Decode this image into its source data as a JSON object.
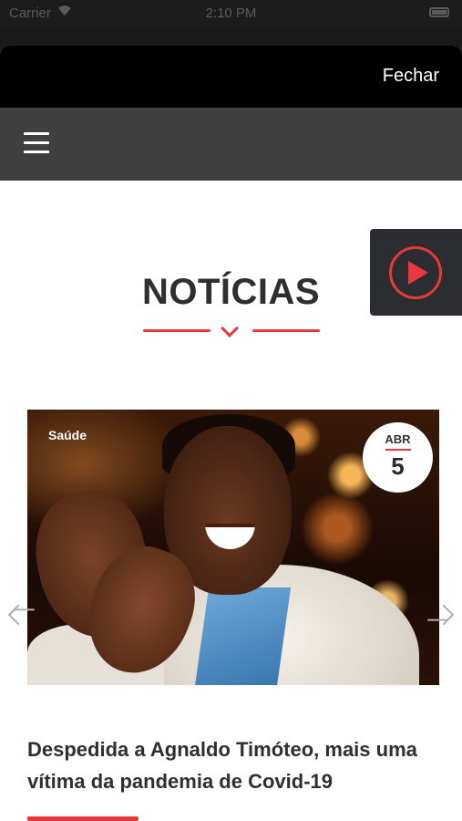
{
  "status_bar": {
    "carrier": "Carrier",
    "time": "2:10 PM"
  },
  "modal": {
    "close_label": "Fechar"
  },
  "section": {
    "title": "NOTÍCIAS"
  },
  "article": {
    "category": "Saúde",
    "date_month": "ABR",
    "date_day": "5",
    "headline": "Despedida a Agnaldo Timóteo, mais uma vítima da pandemia de Covid-19"
  },
  "icons": {
    "menu": "hamburger-menu-icon",
    "radio": "play-circle-icon",
    "prev": "chevron-left-icon",
    "next": "chevron-right-icon"
  },
  "colors": {
    "accent": "#e8383d",
    "nav_bg": "#404040",
    "modal_bar": "#000000",
    "title": "#2f2f2f"
  }
}
